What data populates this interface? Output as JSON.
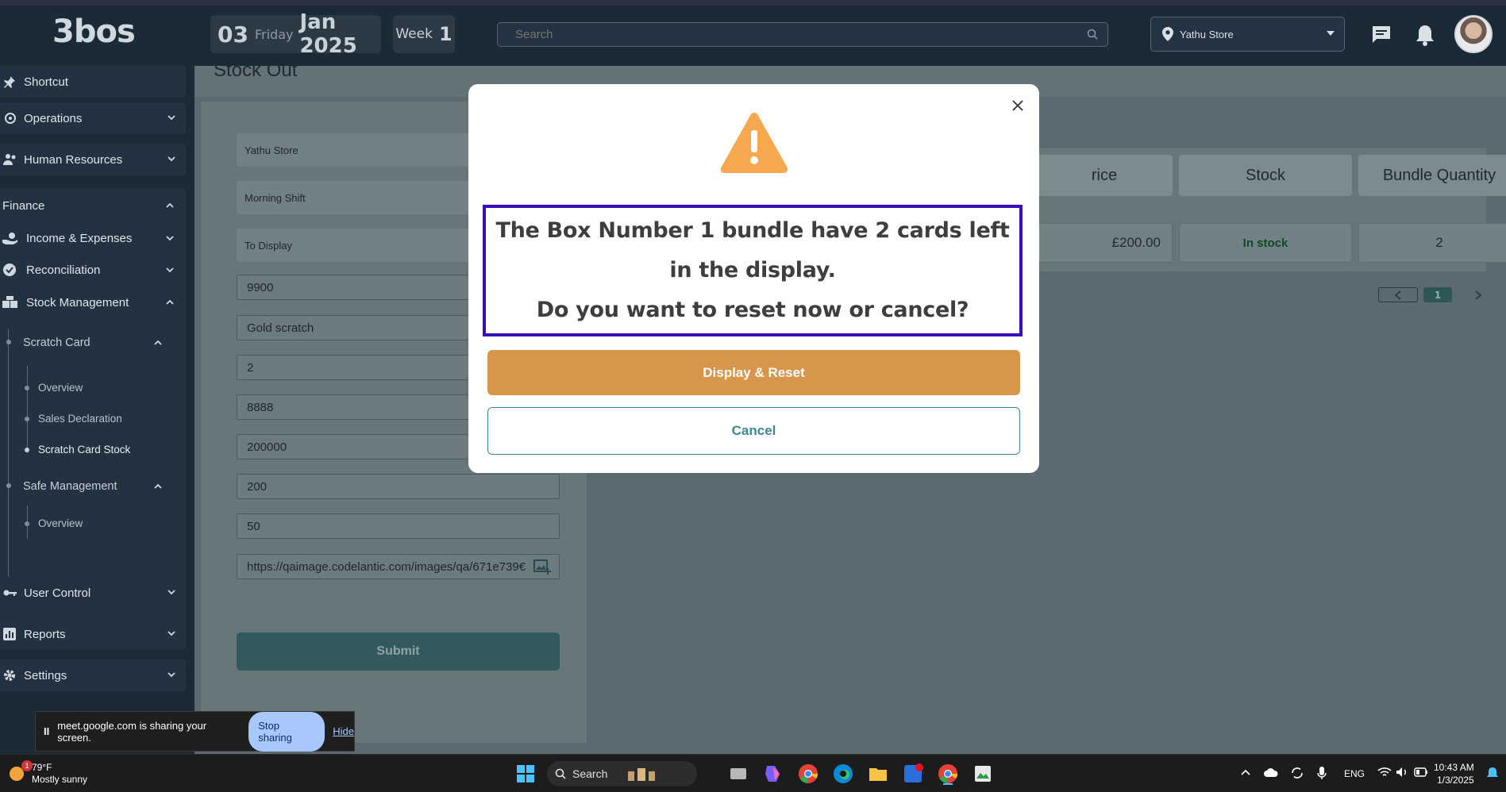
{
  "header": {
    "logo": "3bos",
    "date": {
      "day": "03",
      "weekday": "Friday",
      "month_year": "Jan 2025"
    },
    "week": {
      "label": "Week",
      "number": "1"
    },
    "search_placeholder": "Search",
    "store": "Yathu Store"
  },
  "sidebar": {
    "shortcut": "Shortcut",
    "operations": "Operations",
    "human_resources": "Human Resources",
    "finance": "Finance",
    "income_expenses": "Income & Expenses",
    "reconciliation": "Reconciliation",
    "stock_management": "Stock Management",
    "scratch_card": "Scratch Card",
    "overview": "Overview",
    "sales_declaration": "Sales Declaration",
    "scratch_card_stock": "Scratch Card Stock",
    "safe_management": "Safe Management",
    "safe_overview": "Overview",
    "user_control": "User Control",
    "reports": "Reports",
    "settings": "Settings"
  },
  "page": {
    "title": "Stock Out",
    "form": {
      "store": "Yathu Store",
      "shift": "Morning Shift",
      "destination": "To Display",
      "value_1": "9900",
      "game": "Gold scratch",
      "value_2": "2",
      "value_3": "8888",
      "value_4": "200000",
      "value_5": "200",
      "value_6": "50",
      "image_url": "https://qaimage.codelantic.com/images/qa/671e739€",
      "submit": "Submit"
    },
    "table": {
      "headers": [
        "rice",
        "Stock",
        "Bundle Quantity"
      ],
      "row": [
        "£200.00",
        "In stock",
        "2"
      ]
    },
    "pagination": {
      "current": "1"
    }
  },
  "modal": {
    "message_line1": "The Box Number 1 bundle have 2 cards left in the display.",
    "message_line2": "Do you want to reset now or cancel?",
    "reset_button": "Display & Reset",
    "cancel_button": "Cancel"
  },
  "share_bar": {
    "pause": "II",
    "message": "meet.google.com is sharing your screen.",
    "stop": "Stop sharing",
    "hide": "Hide"
  },
  "taskbar": {
    "weather_temp": "79°F",
    "weather_desc": "Mostly sunny",
    "weather_badge": "1",
    "search": "Search",
    "language": "ENG",
    "time": "10:43 AM",
    "date": "1/3/2025"
  },
  "colors": {
    "modal_accent_border": "#3a0fb8",
    "reset_button": "#d8954c",
    "cancel_border": "#3b8a90",
    "warning": "#f5a84e",
    "in_stock": "#1e7a3a"
  }
}
